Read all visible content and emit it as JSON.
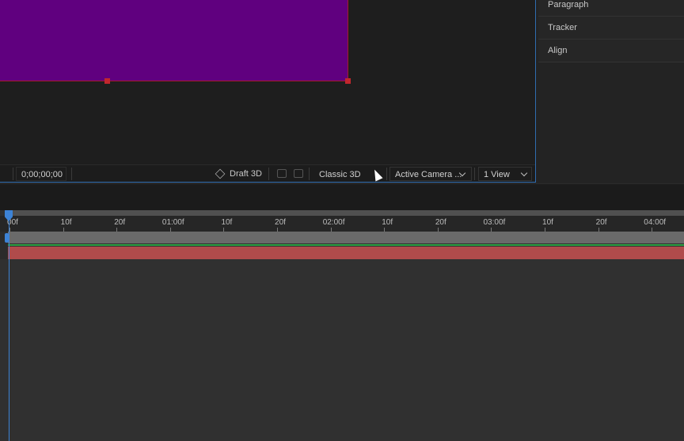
{
  "viewer": {
    "timecode": "0;00;00;00",
    "draft3d_label": "Draft 3D",
    "renderer": "Classic 3D",
    "camera": "Active Camera ...",
    "views": "1 View"
  },
  "side_panels": [
    "Paragraph",
    "Tracker",
    "Align"
  ],
  "timeline": {
    "ruler_labels": [
      "00f",
      "10f",
      "20f",
      "01:00f",
      "10f",
      "20f",
      "02:00f",
      "10f",
      "20f",
      "03:00f",
      "10f",
      "20f",
      "04:00f"
    ]
  },
  "colors": {
    "comp_fill": "#60007f",
    "handle": "#c1272d",
    "playhead": "#3d83d6",
    "layer_bar": "#b04b4b",
    "green_line": "#2ea043"
  }
}
